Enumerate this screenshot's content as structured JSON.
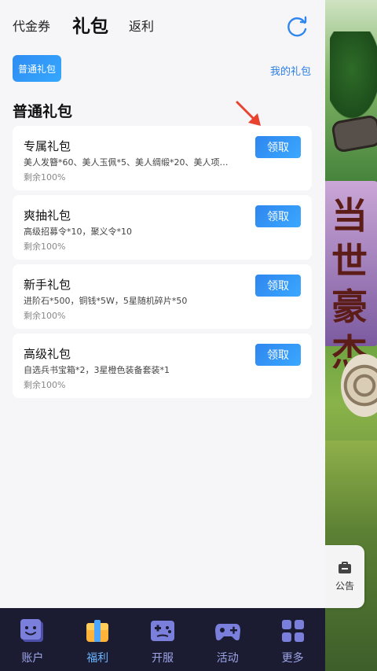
{
  "tabs": {
    "voucher": "代金券",
    "gift": "礼包",
    "rebate": "返利"
  },
  "filter_chip": "普通礼包",
  "my_gifts_link": "我的礼包",
  "section_title": "普通礼包",
  "claim_label": "领取",
  "gifts": [
    {
      "name": "专属礼包",
      "desc": "美人发簪*60、美人玉佩*5、美人绸缎*20、美人项链*...",
      "remain": "剩余100%"
    },
    {
      "name": "爽抽礼包",
      "desc": "高级招募令*10，聚义令*10",
      "remain": "剩余100%"
    },
    {
      "name": "新手礼包",
      "desc": "进阶石*500，铜钱*5W，5星随机碎片*50",
      "remain": "剩余100%"
    },
    {
      "name": "高级礼包",
      "desc": "自选兵书宝箱*2，3星橙色装备套装*1",
      "remain": "剩余100%"
    }
  ],
  "notice_label": "公告",
  "game_banner_text": "当世豪杰",
  "nav": [
    {
      "label": "账户",
      "icon": "account-icon"
    },
    {
      "label": "福利",
      "icon": "gift-box-icon",
      "active": true
    },
    {
      "label": "开服",
      "icon": "server-open-icon"
    },
    {
      "label": "活动",
      "icon": "gamepad-icon"
    },
    {
      "label": "更多",
      "icon": "grid-more-icon"
    }
  ],
  "colors": {
    "accent": "#2f8cf2",
    "nav_bg": "#1b1c32",
    "nav_label": "#9ea4e8",
    "nav_active": "#6ab3ff"
  }
}
